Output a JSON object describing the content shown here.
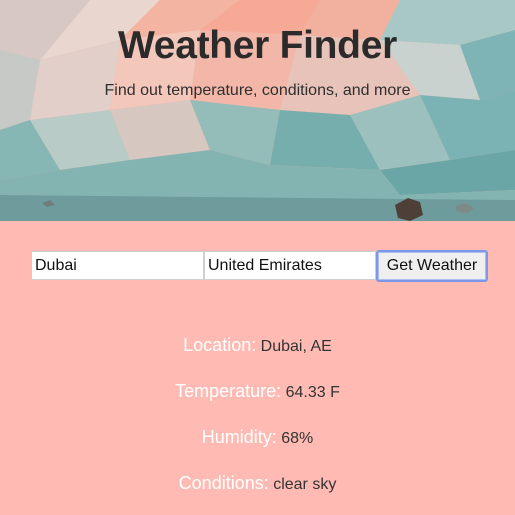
{
  "header": {
    "title": "Weather Finder",
    "subtitle": "Find out temperature, conditions, and more"
  },
  "form": {
    "city_value": "Dubai",
    "country_value": "United Emirates",
    "submit_label": "Get Weather"
  },
  "results": [
    {
      "label": "Location:",
      "value": "Dubai, AE"
    },
    {
      "label": "Temperature:",
      "value": "64.33 F"
    },
    {
      "label": "Humidity:",
      "value": "68%"
    },
    {
      "label": "Conditions:",
      "value": "clear sky"
    }
  ],
  "colors": {
    "page_background": "#ffbbb3",
    "label_text": "#ffffff",
    "value_text": "#333333",
    "button_focus_border": "#7d98e8"
  }
}
